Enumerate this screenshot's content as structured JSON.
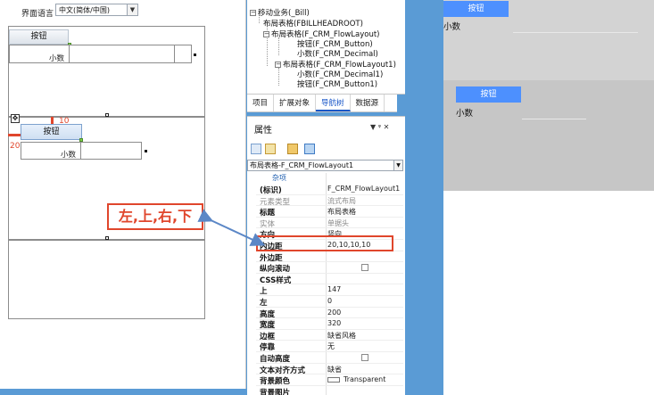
{
  "designer": {
    "lang_label": "界面语言",
    "lang_value": "中文(简体/中国)",
    "top_button_label": "按钮",
    "top_field_label": "小数",
    "offset_top_label": "10",
    "offset_left_label": "20",
    "selected_button_label": "按钮",
    "selected_field_label": "小数"
  },
  "callout": {
    "text": "左,上,右,下"
  },
  "tree": {
    "items": [
      {
        "text": "移动业务(_Bill)",
        "expander": "−"
      },
      {
        "text": "布局表格(FBILLHEADROOT)",
        "expander": ""
      },
      {
        "text": "布局表格(F_CRM_FlowLayout)",
        "expander": "−"
      },
      {
        "text": "按钮(F_CRM_Button)",
        "expander": ""
      },
      {
        "text": "小数(F_CRM_Decimal)",
        "expander": ""
      },
      {
        "text": "布局表格(F_CRM_FlowLayout1)",
        "expander": "−"
      },
      {
        "text": "小数(F_CRM_Decimal1)",
        "expander": ""
      },
      {
        "text": "按钮(F_CRM_Button1)",
        "expander": ""
      }
    ]
  },
  "tabs": [
    {
      "label": "项目"
    },
    {
      "label": "扩展对象"
    },
    {
      "label": "导航树"
    },
    {
      "label": "数据源"
    }
  ],
  "properties": {
    "title": "属性",
    "pin_icons": "▼ ᵠ ✕",
    "object_select": "布局表格-F_CRM_FlowLayout1",
    "category": "杂项",
    "rows": [
      {
        "key": "(标识)",
        "value": "F_CRM_FlowLayout1",
        "dim": false
      },
      {
        "key": "元素类型",
        "value": "流式布局",
        "dim": true
      },
      {
        "key": "标题",
        "value": "布局表格",
        "dim": false
      },
      {
        "key": "实体",
        "value": "单据头",
        "dim": true
      },
      {
        "key": "方向",
        "value": "竖向",
        "dim": false
      },
      {
        "key": "内边距",
        "value": "20,10,10,10",
        "dim": false
      },
      {
        "key": "外边距",
        "value": "",
        "dim": false
      },
      {
        "key": "纵向滚动",
        "value": "checkbox",
        "dim": false
      },
      {
        "key": "CSS样式",
        "value": "",
        "dim": false
      },
      {
        "key": "上",
        "value": "147",
        "dim": false
      },
      {
        "key": "左",
        "value": "0",
        "dim": false
      },
      {
        "key": "高度",
        "value": "200",
        "dim": false
      },
      {
        "key": "宽度",
        "value": "320",
        "dim": false
      },
      {
        "key": "边框",
        "value": "缺省风格",
        "dim": false
      },
      {
        "key": "停靠",
        "value": "无",
        "dim": false
      },
      {
        "key": "自动高度",
        "value": "checkbox",
        "dim": false
      },
      {
        "key": "文本对齐方式",
        "value": "缺省",
        "dim": false
      },
      {
        "key": "背景颜色",
        "value": "Transparent",
        "dim": false
      },
      {
        "key": "背景图片",
        "value": "",
        "dim": false
      }
    ]
  },
  "preview": {
    "button1_label": "按钮",
    "label1": "小数",
    "button2_label": "按钮",
    "label2": "小数"
  },
  "colors": {
    "accent_red": "#e0462c",
    "preview_button": "#4d90fe",
    "frame_blue": "#5a9bd5"
  }
}
